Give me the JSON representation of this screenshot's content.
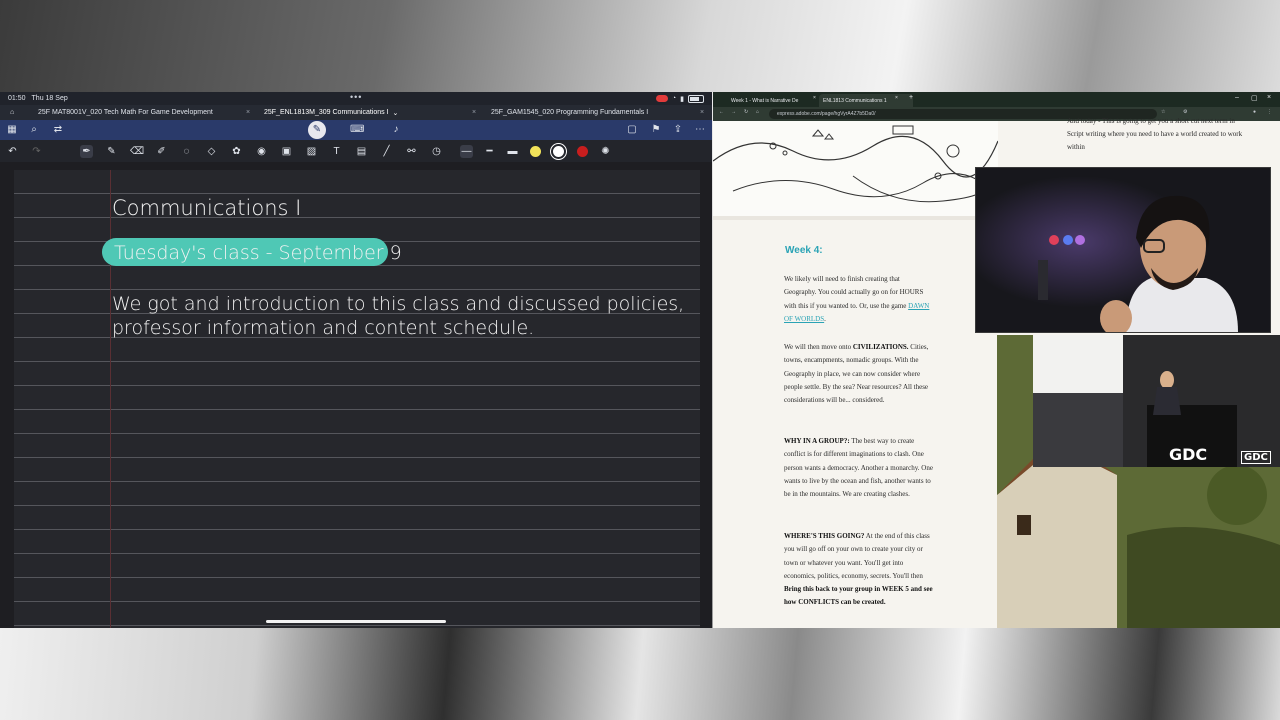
{
  "ipad": {
    "status": {
      "time": "01:50",
      "date": "Thu 18 Sep"
    },
    "tabs": [
      {
        "label": "25F MAT8001V_020 Tech Math For Game Development"
      },
      {
        "label": "25F_ENL1813M_309 Communications I"
      },
      {
        "label": "25F_GAM1545_020 Programming Fundamentals I"
      }
    ],
    "note": {
      "title": "Communications I",
      "heading": "Tuesday's class - September 9",
      "line1": "We got and introduction to this class and discussed policies,",
      "line2": "professor information and content schedule."
    },
    "colors": {
      "highlight": "#4fc8b5",
      "accent": "#2a3a6a",
      "swatch_yellow": "#f2e35a",
      "swatch_white": "#ffffff",
      "swatch_red": "#c81e1e"
    }
  },
  "browser": {
    "tabs": [
      {
        "label": "Week 1 - What is Narrative De"
      },
      {
        "label": "ENL1813 Communications 1"
      }
    ],
    "url": "express.adobe.com/page/hgVyrA4Z7b5Da0/",
    "page": {
      "week_heading": "Week 4:",
      "p1": {
        "text": "We likely will need to finish creating that Geography. You could actually go on for HOURS with this if you wanted to. Or, use the game",
        "link": "DAWN OF WORLDS",
        "end": "."
      },
      "p2": {
        "text_a": "We will then move onto",
        "bold": "CIVILIZATIONS.",
        "text_b": "Cities, towns, encampments, nomadic groups. With the Geography in place, we can now consider where people settle. By the sea? Near resources? All these considerations will be... considered."
      },
      "p3": {
        "bold": "WHY IN A GROUP?:",
        "text": "The best way to create conflict is for different imaginations to clash. One person wants a democracy. Another a monarchy. One wants to live by the ocean and fish, another wants to be in the mountains. We are creating clashes."
      },
      "p4": {
        "bold": "WHERE'S THIS GOING?",
        "text": "At the end of this class you will go off on your own to create your city or town or whatever you want. You'll get into economics, politics, economy, secrets. You'll then",
        "bold2": "Bring this back to your group in WEEK 5 and see how CONFLICTS can be created."
      },
      "right_text": "And today - This is going to get you a short cut next term in Script writing where you need to have a world created to work within"
    }
  },
  "gdc": {
    "logo": "GDC",
    "logo_small": "GDC"
  }
}
